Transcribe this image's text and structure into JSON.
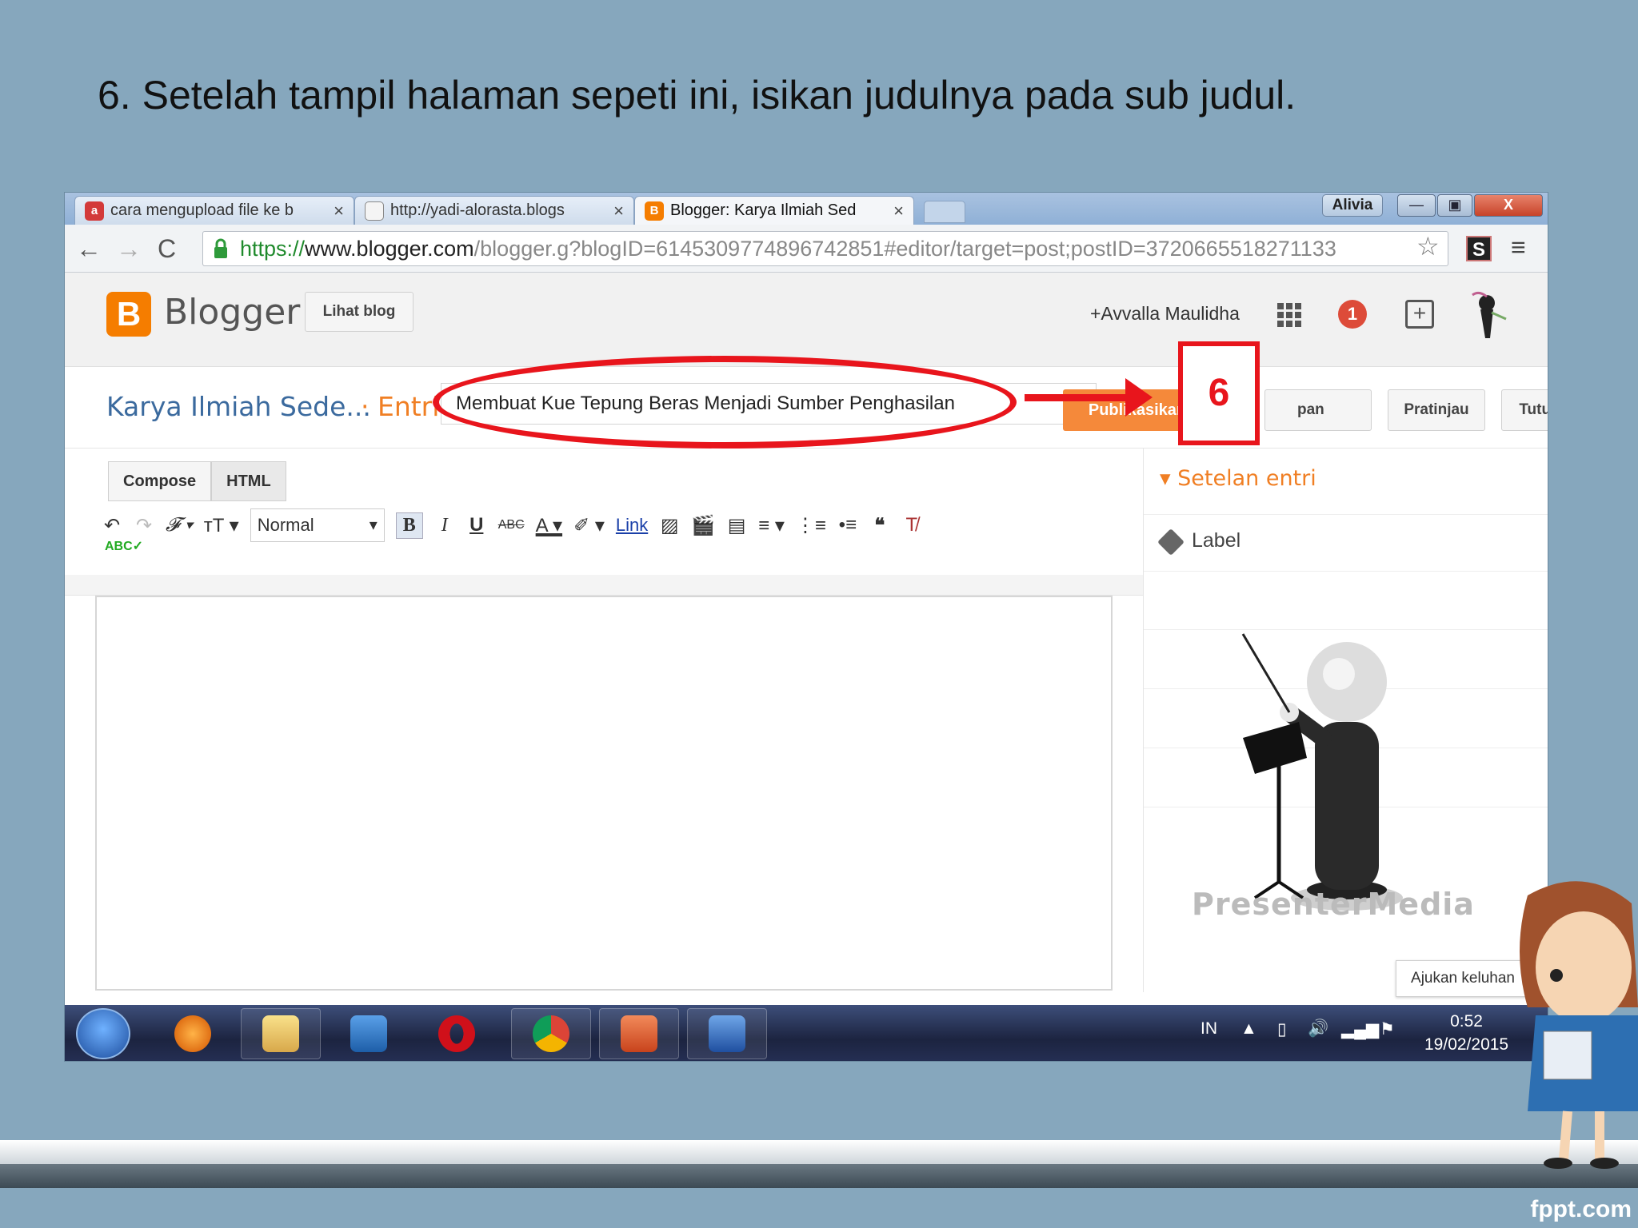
{
  "slide": {
    "title": "6. Setelah tampil halaman sepeti ini, isikan judulnya pada sub judul.",
    "brand": "fppt.com"
  },
  "browser": {
    "tabs": [
      {
        "label": "cara mengupload file ke b",
        "close": "×",
        "favicon_color": "#d33a3a",
        "favicon_text": "ask"
      },
      {
        "label": "http://yadi-alorasta.blogs",
        "close": "×",
        "favicon_color": "#f4f4f4",
        "favicon_text": ""
      },
      {
        "label": "Blogger: Karya Ilmiah Sed",
        "close": "×",
        "favicon_color": "#f57d00",
        "favicon_text": "B"
      }
    ],
    "profile_label": "Alivia",
    "window_min": "—",
    "window_max": "▣",
    "window_close": "X",
    "url_scheme": "https://",
    "url_host": "www.blogger.com",
    "url_path": "/blogger.g?blogID=6145309774896742851#editor/target=post;postID=3720665518271133",
    "ext_label": "S"
  },
  "blogger": {
    "logo_letter": "B",
    "name": "Blogger",
    "view_blog": "Lihat blog",
    "user": "+Avvalla Maulidha",
    "notification_count": "1",
    "blog_title": "Karya Ilmiah Sede...",
    "entry_label": "· Entri",
    "post_title": "Membuat Kue Tepung Beras Menjadi Sumber Penghasilan",
    "publish": "Publikasikan",
    "save": "Simpan",
    "save_visible": "pan",
    "preview": "Pratinjau",
    "close": "Tutup"
  },
  "annotation": {
    "step": "6"
  },
  "editor": {
    "tab_compose": "Compose",
    "tab_html": "HTML",
    "font_size_select": "Normal",
    "link_label": "Link"
  },
  "sidebar": {
    "section_title": "Setelan entri",
    "label_item": "Label",
    "watermark": "PresenterMedia"
  },
  "feedback_button": "Ajukan keluhan",
  "taskbar": {
    "lang": "IN",
    "time": "0:52",
    "date": "19/02/2015"
  },
  "colors": {
    "accent_red": "#e8151c",
    "blogger_orange": "#f57d00",
    "slide_bg": "#86a7bd"
  }
}
